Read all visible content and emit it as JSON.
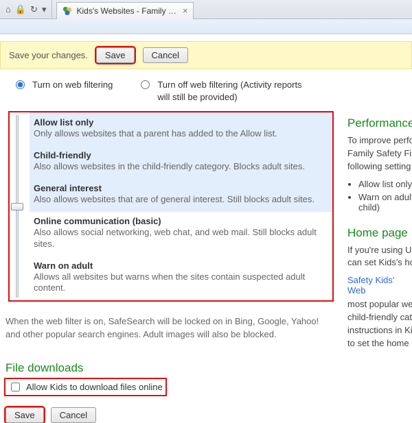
{
  "browser": {
    "tab_title": "Kids's Websites - Family Sa...",
    "tab_close": "×"
  },
  "notice": {
    "message": "Save your changes.",
    "save": "Save",
    "cancel": "Cancel"
  },
  "filter_toggle": {
    "on": "Turn on web filtering",
    "off": "Turn off web filtering (Activity reports will still be provided)",
    "selected": "on"
  },
  "levels": [
    {
      "title": "Allow list only",
      "desc": "Only allows websites that a parent has added to the Allow list.",
      "selected": true
    },
    {
      "title": "Child-friendly",
      "desc": "Also allows websites in the child-friendly category. Blocks adult sites.",
      "selected": true
    },
    {
      "title": "General interest",
      "desc": "Also allows websites that are of general interest. Still blocks adult sites.",
      "selected": true
    },
    {
      "title": "Online communication (basic)",
      "desc": "Also allows social networking, web chat, and web mail. Still blocks adult sites.",
      "selected": false
    },
    {
      "title": "Warn on adult",
      "desc": "Allows all websites but warns when the sites contain suspected adult content.",
      "selected": false
    }
  ],
  "safesearch_note": "When the web filter is on, SafeSearch will be locked on in Bing, Google, Yahoo! and other popular search engines. Adult images will also be blocked.",
  "downloads": {
    "heading": "File downloads",
    "checkbox_label": "Allow Kids to download files online",
    "checked": false
  },
  "bottom": {
    "save": "Save",
    "cancel": "Cancel"
  },
  "side": {
    "perf_h": "Performance",
    "perf_p": "To improve perfo\nFamily Safety Filt\nfollowing setting",
    "perf_li1": "Allow list only",
    "perf_li2": "Warn on adult\nchild)",
    "home_h": "Home page",
    "home_p1": "If you're using U\ncan set Kids's ho",
    "home_link": "Safety Kids' Web",
    "home_p2": "most popular we\nchild-friendly cat\ninstructions in Ki\nto set the home"
  }
}
